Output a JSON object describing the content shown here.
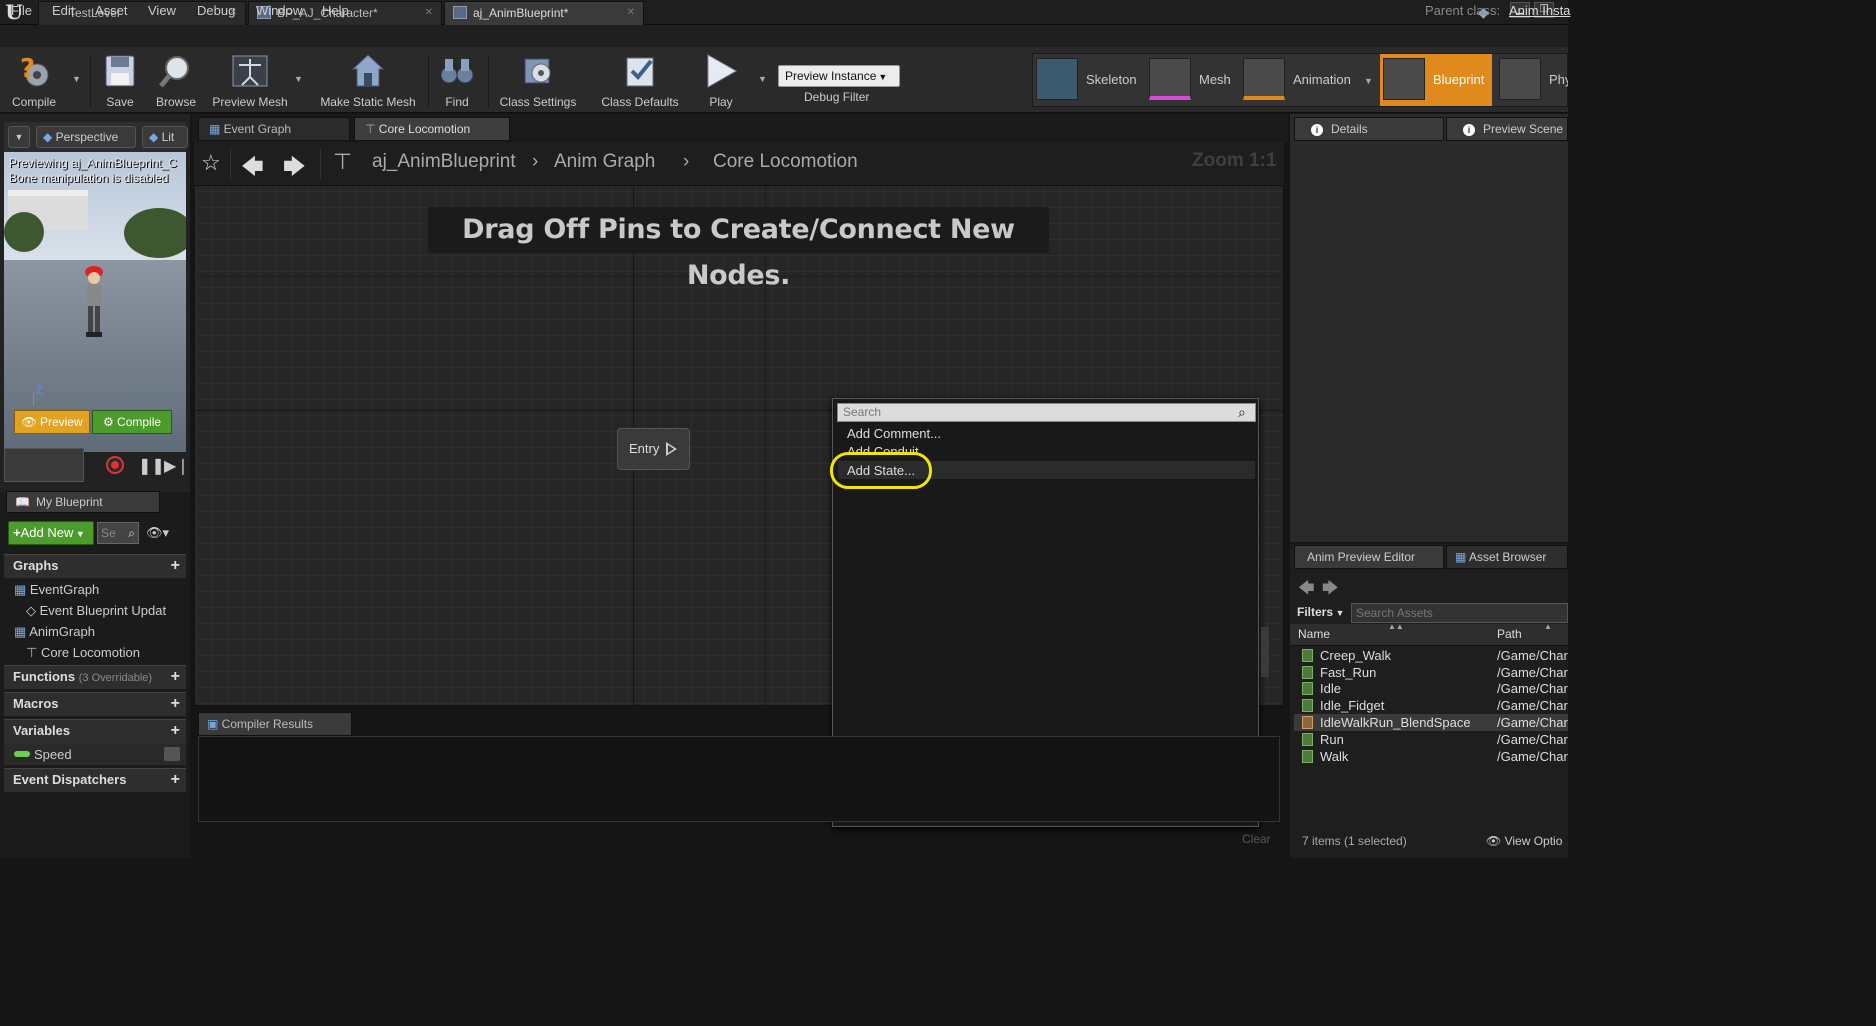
{
  "titlebar": {
    "tabs": [
      {
        "label": "TestLevel"
      },
      {
        "label": "BP_AJ_Character*"
      },
      {
        "label": "aj_AnimBlueprint*"
      }
    ]
  },
  "menubar": {
    "items": [
      "File",
      "Edit",
      "Asset",
      "View",
      "Debug",
      "Window",
      "Help"
    ],
    "parent_class_label": "Parent class:",
    "parent_class_value": "Anim Insta"
  },
  "toolbar": {
    "compile": "Compile",
    "save": "Save",
    "browse": "Browse",
    "preview_mesh": "Preview Mesh",
    "make_static_mesh": "Make Static Mesh",
    "find": "Find",
    "class_settings": "Class Settings",
    "class_defaults": "Class Defaults",
    "play": "Play",
    "preview_instance": "Preview Instance",
    "debug_filter": "Debug Filter"
  },
  "modes": [
    "Skeleton",
    "Mesh",
    "Animation",
    "Blueprint",
    "Phy"
  ],
  "viewport": {
    "perspective": "Perspective",
    "lit": "Lit",
    "line1": "Previewing aj_AnimBlueprint_C",
    "line2": "Bone manipulation is disabled",
    "axis_label": "Z",
    "preview_btn": "Preview",
    "compile_btn": "Compile"
  },
  "my_blueprint": {
    "tab": "My Blueprint",
    "add_new": "Add New",
    "search_placeholder": "Se",
    "graphs": "Graphs",
    "event_graph": "EventGraph",
    "event_blueprint_update": "Event Blueprint Updat",
    "anim_graph": "AnimGraph",
    "core_locomotion": "Core Locomotion",
    "functions": "Functions",
    "functions_sub": "(3 Overridable)",
    "macros": "Macros",
    "variables": "Variables",
    "speed": "Speed",
    "event_dispatchers": "Event Dispatchers"
  },
  "graph": {
    "tabs": [
      "Event Graph",
      "Core Locomotion"
    ],
    "breadcrumb": [
      "aj_AnimBlueprint",
      "Anim Graph",
      "Core Locomotion"
    ],
    "zoom": "Zoom 1:1",
    "hint": "Drag Off Pins to Create/Connect New Nodes.",
    "entry_node": "Entry"
  },
  "context_menu": {
    "search_placeholder": "Search",
    "items": [
      "Add Comment...",
      "Add Conduit...",
      "Add State..."
    ]
  },
  "compiler": {
    "tab": "Compiler Results",
    "clear": "Clear"
  },
  "details": {
    "tab": "Details",
    "tab2": "Preview Scene S"
  },
  "assets": {
    "tab1": "Anim Preview Editor",
    "tab2": "Asset Browser",
    "filters": "Filters",
    "search_placeholder": "Search Assets",
    "col_name": "Name",
    "col_path": "Path",
    "rows": [
      {
        "name": "Creep_Walk",
        "path": "/Game/Char"
      },
      {
        "name": "Fast_Run",
        "path": "/Game/Char"
      },
      {
        "name": "Idle",
        "path": "/Game/Char"
      },
      {
        "name": "Idle_Fidget",
        "path": "/Game/Char"
      },
      {
        "name": "IdleWalkRun_BlendSpace",
        "path": "/Game/Char"
      },
      {
        "name": "Run",
        "path": "/Game/Char"
      },
      {
        "name": "Walk",
        "path": "/Game/Char"
      }
    ],
    "count": "7 items (1 selected)",
    "view_options": "View Optio"
  },
  "colors": {
    "accent_orange": "#e08a1e",
    "compile_green": "#4b9c2a",
    "highlight_yellow": "#f4e500"
  }
}
